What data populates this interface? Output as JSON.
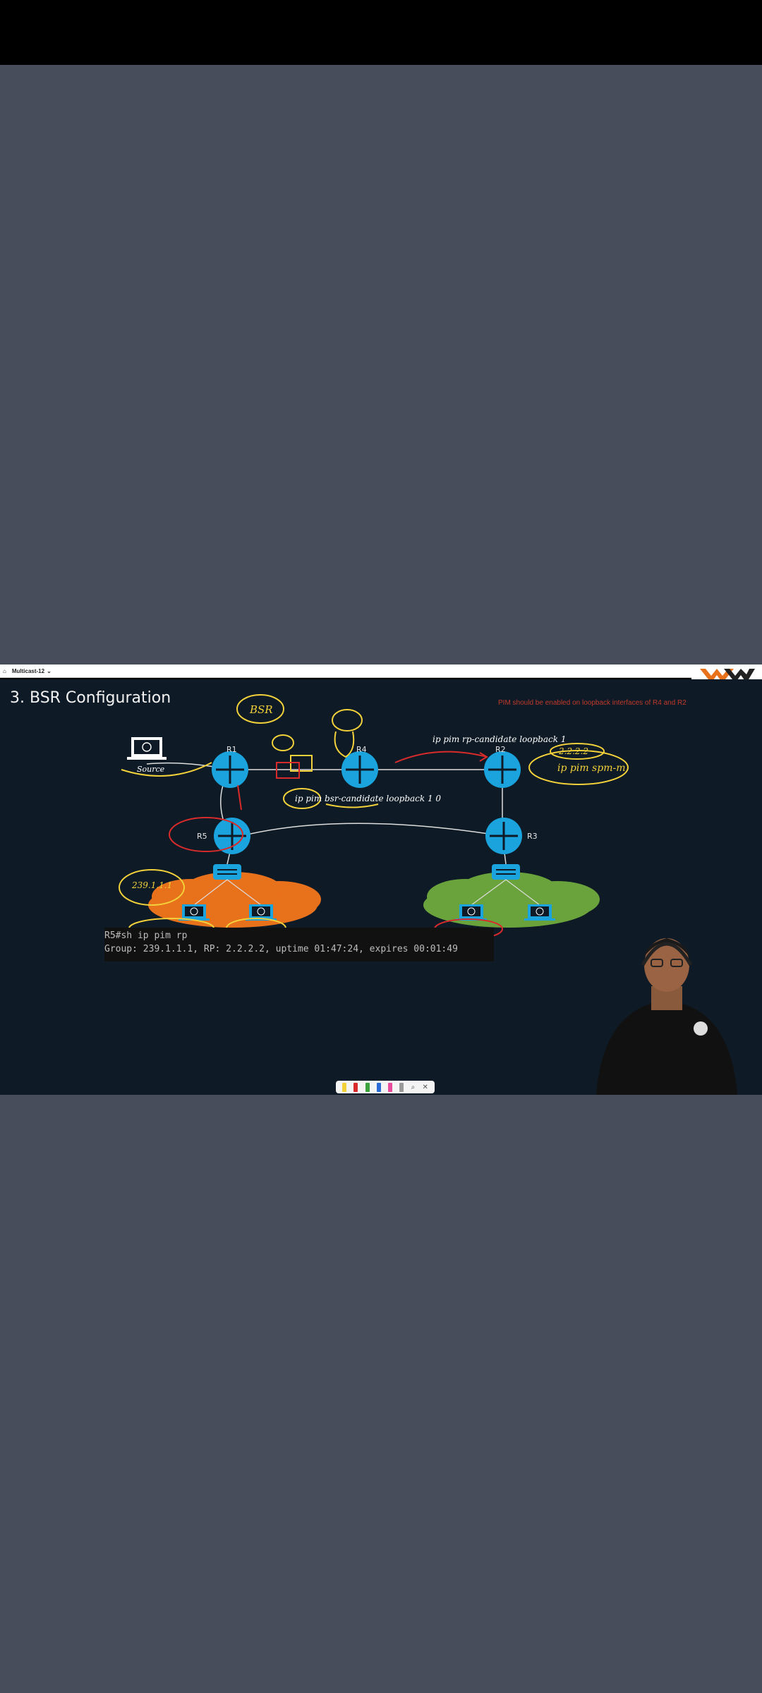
{
  "window": {
    "tab_label": "Multicast-12"
  },
  "slide": {
    "title": "3. BSR Configuration",
    "note": "PIM should be enabled on loopback interfaces of R4 and R2",
    "source_label": "Source",
    "routers": [
      "R1",
      "R4",
      "R2",
      "R5",
      "R3"
    ],
    "rp_candidate_text": "ip pim rp-candidate loopback 1",
    "bsr_candidate_text": "ip pim bsr-candidate loopback 1 0",
    "annotations": {
      "bsr": "BSR",
      "rp_addr": "2.2.2.2",
      "sparse_mode": "ip pim spm-m",
      "group": "239.1.1.1"
    }
  },
  "terminal": {
    "line1": "R5#sh ip pim rp",
    "line2": "Group: 239.1.1.1, RP: 2.2.2.2, uptime 01:47:24, expires 00:01:49"
  },
  "colors": {
    "router": "#1aa3dc",
    "annotation_yellow": "#f2d13a",
    "annotation_red": "#d92b2b",
    "cloud_orange": "#e8711c",
    "cloud_green": "#6aa33c"
  }
}
